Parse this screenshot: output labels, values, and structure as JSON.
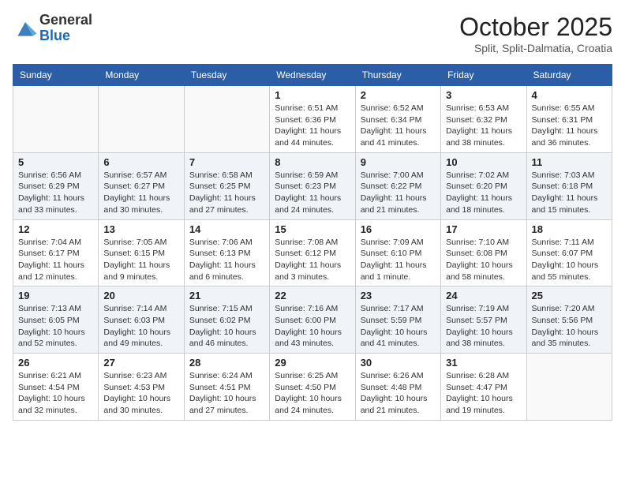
{
  "logo": {
    "general": "General",
    "blue": "Blue"
  },
  "title": "October 2025",
  "subtitle": "Split, Split-Dalmatia, Croatia",
  "days_of_week": [
    "Sunday",
    "Monday",
    "Tuesday",
    "Wednesday",
    "Thursday",
    "Friday",
    "Saturday"
  ],
  "weeks": [
    [
      {
        "day": "",
        "info": ""
      },
      {
        "day": "",
        "info": ""
      },
      {
        "day": "",
        "info": ""
      },
      {
        "day": "1",
        "info": "Sunrise: 6:51 AM\nSunset: 6:36 PM\nDaylight: 11 hours and 44 minutes."
      },
      {
        "day": "2",
        "info": "Sunrise: 6:52 AM\nSunset: 6:34 PM\nDaylight: 11 hours and 41 minutes."
      },
      {
        "day": "3",
        "info": "Sunrise: 6:53 AM\nSunset: 6:32 PM\nDaylight: 11 hours and 38 minutes."
      },
      {
        "day": "4",
        "info": "Sunrise: 6:55 AM\nSunset: 6:31 PM\nDaylight: 11 hours and 36 minutes."
      }
    ],
    [
      {
        "day": "5",
        "info": "Sunrise: 6:56 AM\nSunset: 6:29 PM\nDaylight: 11 hours and 33 minutes."
      },
      {
        "day": "6",
        "info": "Sunrise: 6:57 AM\nSunset: 6:27 PM\nDaylight: 11 hours and 30 minutes."
      },
      {
        "day": "7",
        "info": "Sunrise: 6:58 AM\nSunset: 6:25 PM\nDaylight: 11 hours and 27 minutes."
      },
      {
        "day": "8",
        "info": "Sunrise: 6:59 AM\nSunset: 6:23 PM\nDaylight: 11 hours and 24 minutes."
      },
      {
        "day": "9",
        "info": "Sunrise: 7:00 AM\nSunset: 6:22 PM\nDaylight: 11 hours and 21 minutes."
      },
      {
        "day": "10",
        "info": "Sunrise: 7:02 AM\nSunset: 6:20 PM\nDaylight: 11 hours and 18 minutes."
      },
      {
        "day": "11",
        "info": "Sunrise: 7:03 AM\nSunset: 6:18 PM\nDaylight: 11 hours and 15 minutes."
      }
    ],
    [
      {
        "day": "12",
        "info": "Sunrise: 7:04 AM\nSunset: 6:17 PM\nDaylight: 11 hours and 12 minutes."
      },
      {
        "day": "13",
        "info": "Sunrise: 7:05 AM\nSunset: 6:15 PM\nDaylight: 11 hours and 9 minutes."
      },
      {
        "day": "14",
        "info": "Sunrise: 7:06 AM\nSunset: 6:13 PM\nDaylight: 11 hours and 6 minutes."
      },
      {
        "day": "15",
        "info": "Sunrise: 7:08 AM\nSunset: 6:12 PM\nDaylight: 11 hours and 3 minutes."
      },
      {
        "day": "16",
        "info": "Sunrise: 7:09 AM\nSunset: 6:10 PM\nDaylight: 11 hours and 1 minute."
      },
      {
        "day": "17",
        "info": "Sunrise: 7:10 AM\nSunset: 6:08 PM\nDaylight: 10 hours and 58 minutes."
      },
      {
        "day": "18",
        "info": "Sunrise: 7:11 AM\nSunset: 6:07 PM\nDaylight: 10 hours and 55 minutes."
      }
    ],
    [
      {
        "day": "19",
        "info": "Sunrise: 7:13 AM\nSunset: 6:05 PM\nDaylight: 10 hours and 52 minutes."
      },
      {
        "day": "20",
        "info": "Sunrise: 7:14 AM\nSunset: 6:03 PM\nDaylight: 10 hours and 49 minutes."
      },
      {
        "day": "21",
        "info": "Sunrise: 7:15 AM\nSunset: 6:02 PM\nDaylight: 10 hours and 46 minutes."
      },
      {
        "day": "22",
        "info": "Sunrise: 7:16 AM\nSunset: 6:00 PM\nDaylight: 10 hours and 43 minutes."
      },
      {
        "day": "23",
        "info": "Sunrise: 7:17 AM\nSunset: 5:59 PM\nDaylight: 10 hours and 41 minutes."
      },
      {
        "day": "24",
        "info": "Sunrise: 7:19 AM\nSunset: 5:57 PM\nDaylight: 10 hours and 38 minutes."
      },
      {
        "day": "25",
        "info": "Sunrise: 7:20 AM\nSunset: 5:56 PM\nDaylight: 10 hours and 35 minutes."
      }
    ],
    [
      {
        "day": "26",
        "info": "Sunrise: 6:21 AM\nSunset: 4:54 PM\nDaylight: 10 hours and 32 minutes."
      },
      {
        "day": "27",
        "info": "Sunrise: 6:23 AM\nSunset: 4:53 PM\nDaylight: 10 hours and 30 minutes."
      },
      {
        "day": "28",
        "info": "Sunrise: 6:24 AM\nSunset: 4:51 PM\nDaylight: 10 hours and 27 minutes."
      },
      {
        "day": "29",
        "info": "Sunrise: 6:25 AM\nSunset: 4:50 PM\nDaylight: 10 hours and 24 minutes."
      },
      {
        "day": "30",
        "info": "Sunrise: 6:26 AM\nSunset: 4:48 PM\nDaylight: 10 hours and 21 minutes."
      },
      {
        "day": "31",
        "info": "Sunrise: 6:28 AM\nSunset: 4:47 PM\nDaylight: 10 hours and 19 minutes."
      },
      {
        "day": "",
        "info": ""
      }
    ]
  ]
}
